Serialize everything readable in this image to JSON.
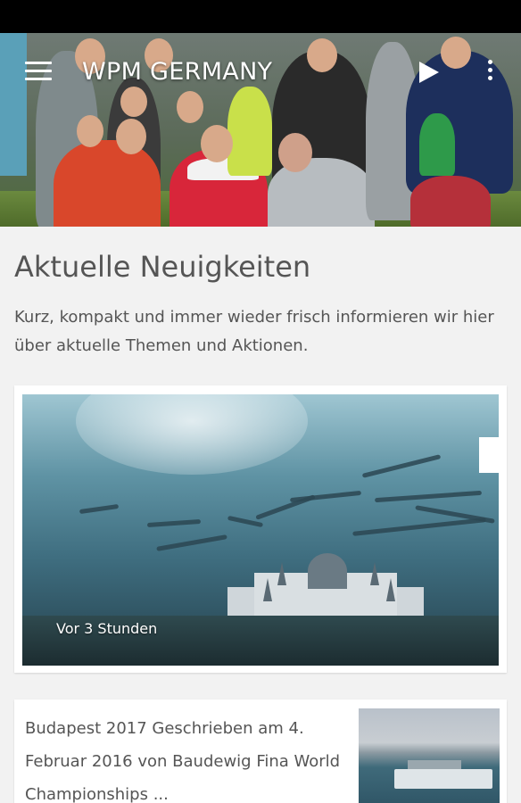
{
  "app_bar": {
    "title": "WPM GERMANY",
    "icons": [
      "menu-icon",
      "play-icon",
      "more-vert-icon"
    ]
  },
  "news_section": {
    "title": "Aktuelle Neuigkeiten",
    "description": "Kurz, kompakt und immer wieder frisch informieren wir hier über aktuelle Themen und Aktionen."
  },
  "cards": [
    {
      "time_label": "Vor 3 Stunden"
    },
    {
      "text": "Budapest 2017 Geschrieben am 4. Februar 2016 von Baudewig Fina World Championships ..."
    }
  ],
  "colors": {
    "background": "#f2f2f2",
    "card": "#ffffff",
    "text": "#555555",
    "app_bar_text": "#ffffff"
  }
}
